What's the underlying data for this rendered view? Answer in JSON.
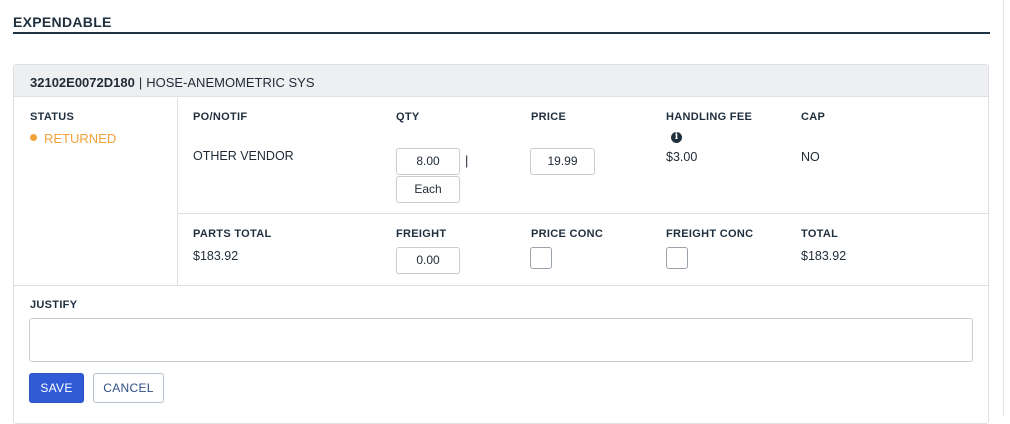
{
  "section": {
    "title": "EXPENDABLE"
  },
  "item": {
    "part_number": "32102E0072D180",
    "separator": "|",
    "description": "HOSE-ANEMOMETRIC SYS"
  },
  "status": {
    "label": "STATUS",
    "value": "RETURNED",
    "color": "#f2a23a"
  },
  "row1": {
    "po_notif": {
      "label": "PO/NOTIF",
      "value": "OTHER VENDOR"
    },
    "qty": {
      "label": "QTY",
      "value": "8.00",
      "separator": "|",
      "unit": "Each"
    },
    "price": {
      "label": "PRICE",
      "value": "19.99"
    },
    "handling_fee": {
      "label": "HANDLING FEE",
      "info_icon": "info-icon",
      "info_glyph": "i",
      "value": "$3.00"
    },
    "cap": {
      "label": "CAP",
      "value": "NO"
    }
  },
  "row2": {
    "parts_total": {
      "label": "PARTS TOTAL",
      "value": "$183.92"
    },
    "freight": {
      "label": "FREIGHT",
      "value": "0.00"
    },
    "price_conc": {
      "label": "PRICE CONC",
      "checked": false
    },
    "freight_conc": {
      "label": "FREIGHT CONC",
      "checked": false
    },
    "total": {
      "label": "TOTAL",
      "value": "$183.92"
    }
  },
  "justify": {
    "label": "JUSTIFY",
    "value": ""
  },
  "actions": {
    "save_label": "SAVE",
    "cancel_label": "CANCEL"
  },
  "colors": {
    "accent": "#2f5bd6",
    "header_rule": "#1e3447",
    "status": "#f2a23a"
  }
}
